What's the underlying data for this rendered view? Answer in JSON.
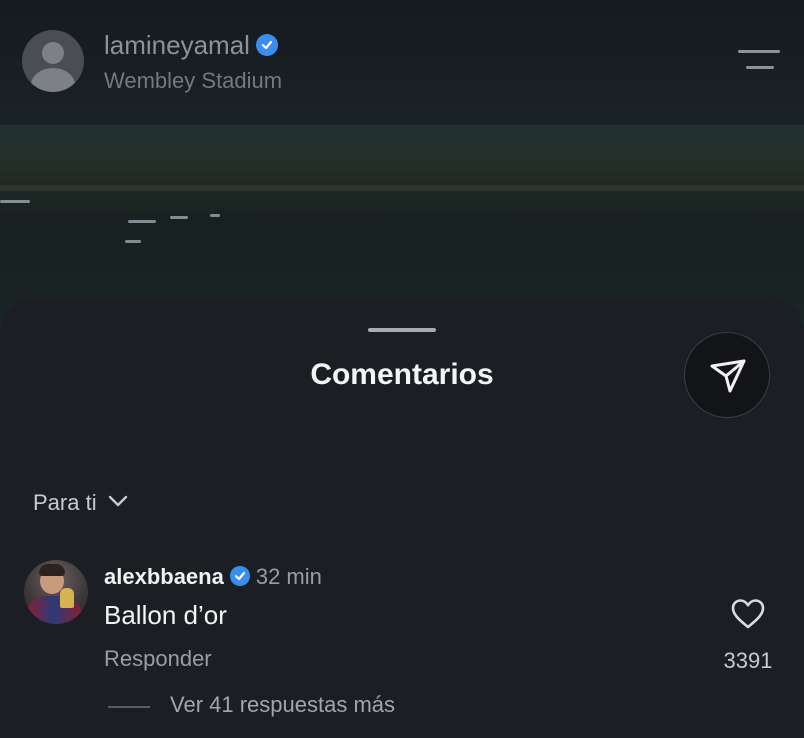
{
  "post": {
    "username": "lamineyamal",
    "verified": true,
    "location": "Wembley Stadium",
    "menu_icon": "hamburger-menu-icon"
  },
  "comments_sheet": {
    "title": "Comentarios",
    "share_icon": "paper-plane-icon",
    "filter_label": "Para ti",
    "filter_icon": "chevron-down-icon"
  },
  "comments": [
    {
      "username": "alexbbaena",
      "verified": true,
      "time": "32 min",
      "text": "Ballon d’or",
      "reply_label": "Responder",
      "like_icon": "heart-icon",
      "like_count": "3391",
      "replies_label": "Ver 41 respuestas más"
    }
  ],
  "colors": {
    "verified_badge": "#3a8ef0",
    "sheet_background": "#1b1e22"
  }
}
